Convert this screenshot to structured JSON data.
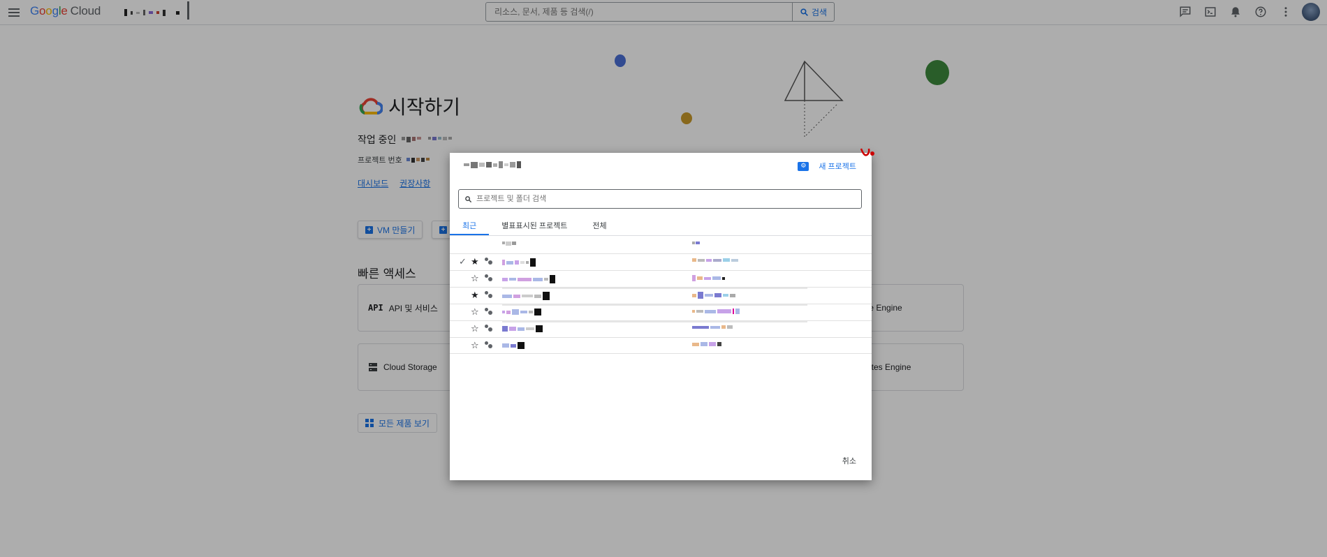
{
  "topbar": {
    "logo_google": [
      "G",
      "o",
      "o",
      "g",
      "l",
      "e"
    ],
    "logo_cloud": "Cloud",
    "search_placeholder": "리소스, 문서, 제품 등 검색(/)",
    "search_button": "검색",
    "icons": [
      "chat-icon",
      "terminal-icon",
      "bell-icon",
      "help-icon",
      "more-vert-icon"
    ]
  },
  "page": {
    "title": "시작하기",
    "working_label": "작업 중인",
    "project_number_label": "프로젝트 번호",
    "links": [
      "대시보드",
      "권장사항"
    ],
    "vm_button": "VM 만들기",
    "quick_access_title": "빠른 액세스",
    "cards": {
      "api": "API 및 서비스",
      "storage": "Cloud Storage",
      "compute_partial": "te Engine",
      "kubernetes_partial": "etes Engine"
    },
    "all_products": "모든 제품 보기"
  },
  "modal": {
    "new_project": "새 프로젝트",
    "search_placeholder": "프로젝트 및 폴더 검색",
    "tabs": [
      "최근",
      "별표표시된 프로젝트",
      "전체"
    ],
    "rows": [
      {
        "selected": true,
        "starred": true
      },
      {
        "selected": false,
        "starred": false
      },
      {
        "selected": false,
        "starred": true
      },
      {
        "selected": false,
        "starred": false
      },
      {
        "selected": false,
        "starred": false
      },
      {
        "selected": false,
        "starred": false
      }
    ],
    "cancel": "취소"
  },
  "colors": {
    "accent": "#1a73e8",
    "overlay": "rgba(0,0,0,0.32)"
  }
}
